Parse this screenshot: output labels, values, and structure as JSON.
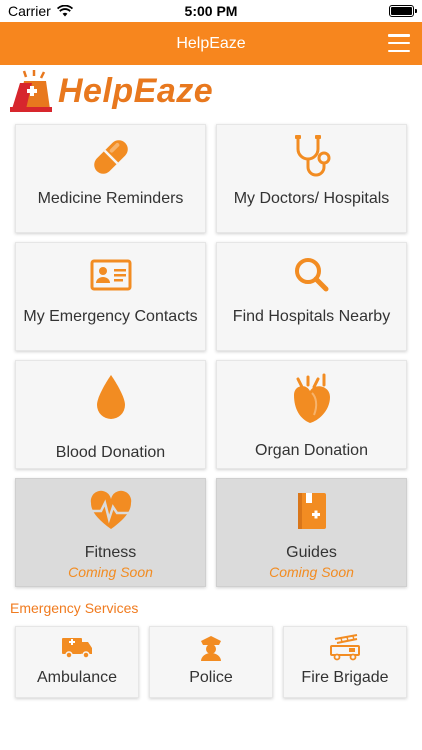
{
  "status_bar": {
    "carrier": "Carrier",
    "time": "5:00 PM"
  },
  "navbar": {
    "title": "HelpEaze"
  },
  "logo": {
    "text": "HelpEaze"
  },
  "colors": {
    "accent": "#f7861e",
    "icon": "#f28c22",
    "card": "#f6f6f6",
    "card_disabled": "#dbdbdb"
  },
  "cards": [
    {
      "label": "Medicine Reminders",
      "icon": "pill-icon",
      "sub": ""
    },
    {
      "label": "My Doctors/ Hospitals",
      "icon": "stethoscope-icon",
      "sub": ""
    },
    {
      "label": "My Emergency Contacts",
      "icon": "contact-card-icon",
      "sub": ""
    },
    {
      "label": "Find Hospitals Nearby",
      "icon": "search-icon",
      "sub": ""
    },
    {
      "label": "Blood Donation",
      "icon": "blood-drop-icon",
      "sub": ""
    },
    {
      "label": "Organ Donation",
      "icon": "organ-heart-icon",
      "sub": ""
    },
    {
      "label": "Fitness",
      "icon": "heartbeat-icon",
      "sub": "Coming Soon"
    },
    {
      "label": "Guides",
      "icon": "guide-book-icon",
      "sub": "Coming Soon"
    }
  ],
  "emergency": {
    "title": "Emergency Services",
    "services": [
      {
        "label": "Ambulance",
        "icon": "ambulance-icon"
      },
      {
        "label": "Police",
        "icon": "police-icon"
      },
      {
        "label": "Fire Brigade",
        "icon": "fire-truck-icon"
      }
    ]
  }
}
